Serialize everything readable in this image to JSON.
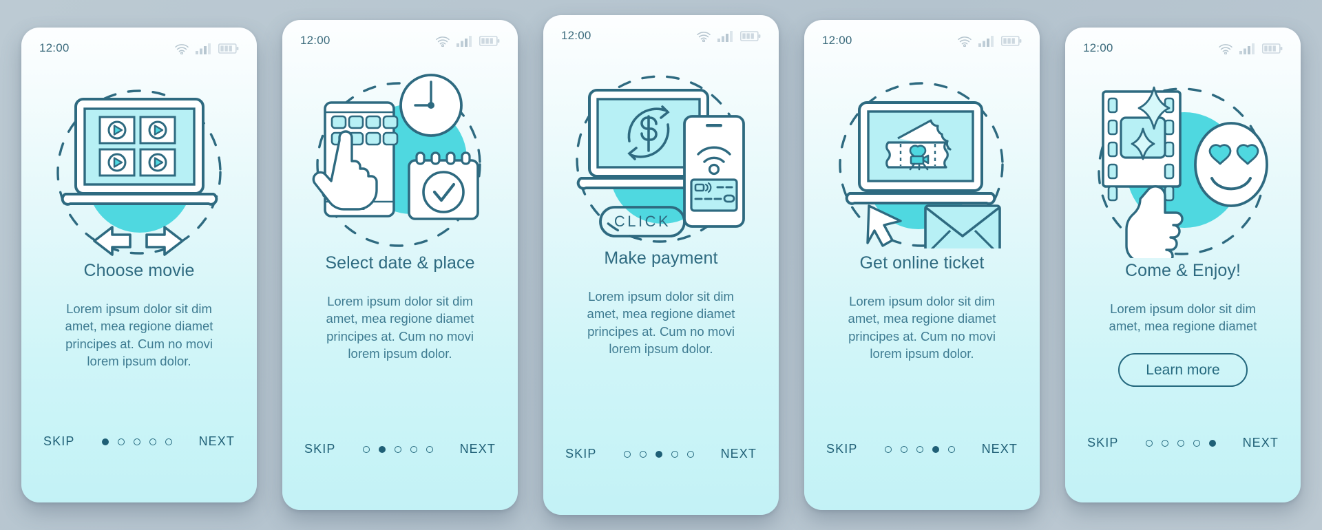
{
  "background_color": "#b9c7d1",
  "theme": {
    "accent": "#4fd8e0",
    "stroke": "#2e6a80",
    "title_color": "#2e6a80",
    "body_color": "#3e7b91",
    "nav_color": "#1f5f76",
    "card_gradient_top": "#fdfeff",
    "card_gradient_bottom": "#c3f2f6"
  },
  "status_bar": {
    "time": "12:00",
    "icons": [
      "wifi-icon",
      "cellular-signal-icon",
      "battery-icon"
    ]
  },
  "nav": {
    "skip_label": "SKIP",
    "next_label": "NEXT",
    "total_dots": 5
  },
  "screens": [
    {
      "id": "choose-movie",
      "title": "Choose movie",
      "description_lines": [
        "Lorem ipsum dolor sit dim",
        "amet, mea regione diamet",
        "principes at. Cum no movi",
        "lorem ipsum dolor."
      ],
      "illustration": "laptop-movie-grid-arrows-icon",
      "active_dot": 1,
      "cta": null
    },
    {
      "id": "select-date-place",
      "title": "Select date & place",
      "description_lines": [
        "Lorem ipsum dolor sit dim",
        "amet, mea regione diamet",
        "principes at. Cum no movi",
        "lorem ipsum dolor."
      ],
      "illustration": "phone-hand-clock-calendar-icon",
      "active_dot": 2,
      "cta": null
    },
    {
      "id": "make-payment",
      "title": "Make payment",
      "description_lines": [
        "Lorem ipsum dolor sit dim",
        "amet, mea regione diamet",
        "principes at. Cum no movi",
        "lorem ipsum dolor."
      ],
      "illustration": "laptop-dollar-phone-card-click-icon",
      "active_dot": 3,
      "cta": null
    },
    {
      "id": "get-online-ticket",
      "title": "Get online ticket",
      "description_lines": [
        "Lorem ipsum dolor sit dim",
        "amet, mea regione diamet",
        "principes at. Cum no movi",
        "lorem ipsum dolor."
      ],
      "illustration": "laptop-ticket-cursor-envelope-icon",
      "active_dot": 4,
      "cta": null
    },
    {
      "id": "come-and-enjoy",
      "title": "Come & Enjoy!",
      "description_lines": [
        "Lorem ipsum dolor sit dim",
        "amet, mea regione diamet"
      ],
      "illustration": "filmstrip-smiley-thumbsup-icon",
      "active_dot": 5,
      "cta": "Learn more"
    }
  ]
}
